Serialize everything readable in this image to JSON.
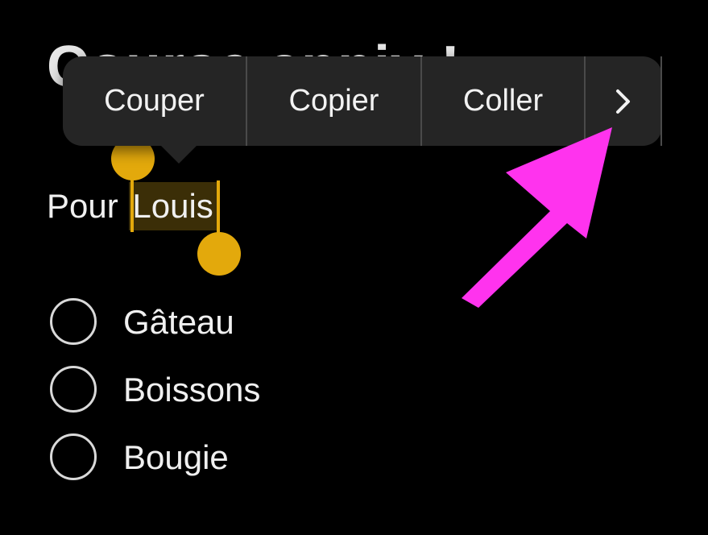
{
  "note": {
    "title": "Course anniv !",
    "subtitle_prefix": "Pour ",
    "selected_word": "Louis"
  },
  "edit_menu": {
    "cut_label": "Couper",
    "copy_label": "Copier",
    "paste_label": "Coller",
    "more_icon": "chevron-right-icon"
  },
  "checklist": {
    "items": [
      {
        "label": "Gâteau",
        "checked": false
      },
      {
        "label": "Boissons",
        "checked": false
      },
      {
        "label": "Bougie",
        "checked": false
      }
    ]
  },
  "colors": {
    "background": "#000000",
    "selection_handle": "#e3a90c",
    "selection_highlight": "#3b2e07",
    "menu_background": "#252525",
    "annotation_arrow": "#ff33ee"
  },
  "annotation": {
    "arrow_icon": "pink-arrow-icon"
  }
}
